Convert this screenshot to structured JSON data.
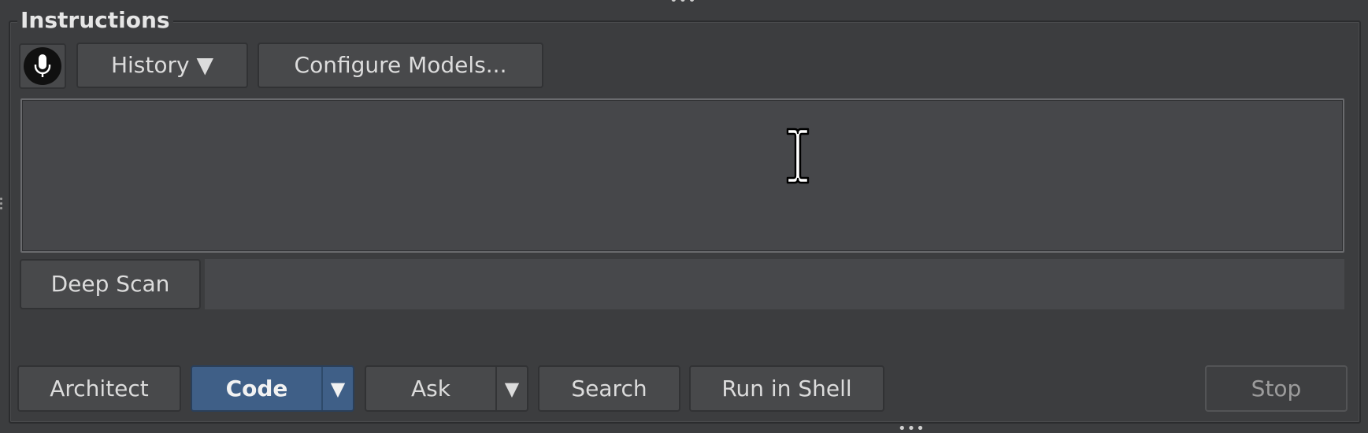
{
  "panel": {
    "title": "Instructions"
  },
  "toolbar": {
    "mic_icon": "microphone-icon",
    "history_label": "History ▼",
    "configure_label": "Configure Models..."
  },
  "instructions_input": {
    "value": "",
    "placeholder": ""
  },
  "deep_scan": {
    "button_label": "Deep Scan",
    "status_text": ""
  },
  "actions": {
    "architect_label": "Architect",
    "code_label": "Code",
    "code_arrow": "▼",
    "ask_label": "Ask",
    "ask_arrow": "▼",
    "search_label": "Search",
    "run_shell_label": "Run in Shell",
    "stop_label": "Stop"
  },
  "colors": {
    "background": "#3c3d3f",
    "active_mode": "#3f5f87",
    "text": "#dcdcdc"
  }
}
